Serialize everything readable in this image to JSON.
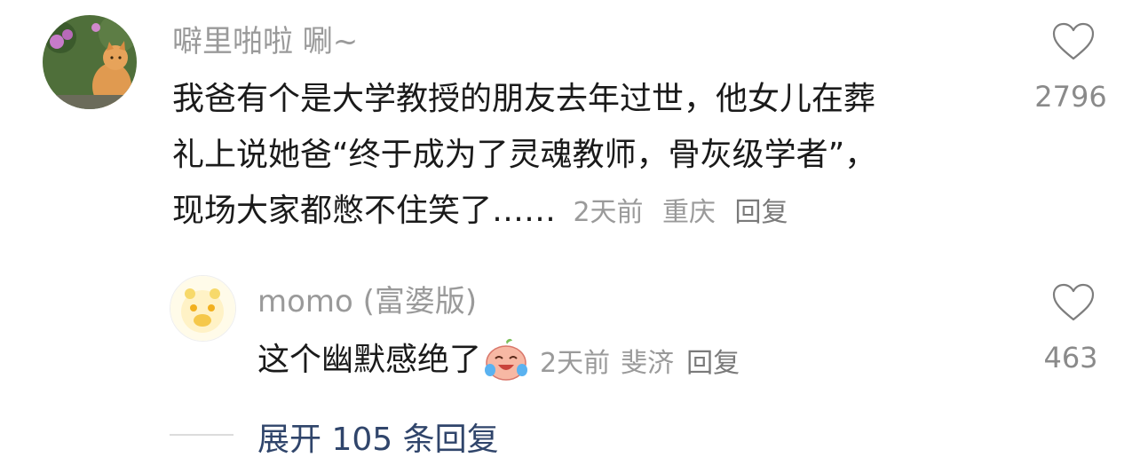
{
  "comment": {
    "username": "噼里啪啦 唰~",
    "lines": [
      "我爸有个是大学教授的朋友去年过世，他女儿在葬",
      "礼上说她爸“终于成为了灵魂教师，骨灰级学者”，",
      "现场大家都憋不住笑了……"
    ],
    "time": "2天前",
    "location": "重庆",
    "reply_label": "回复",
    "like_count": "2796",
    "like_icon": "heart-outline-icon"
  },
  "reply": {
    "username": "momo (富婆版)",
    "text": "这个幽默感绝了",
    "emoji": "crying-laughing-emoji",
    "time": "2天前",
    "location": "斐济",
    "reply_label": "回复",
    "like_count": "463",
    "like_icon": "heart-outline-icon"
  },
  "expand": {
    "label": "展开 105 条回复"
  },
  "colors": {
    "username": "#9a9a9a",
    "text": "#1a1a1a",
    "meta": "#9a9a9a",
    "expand": "#30456b"
  }
}
